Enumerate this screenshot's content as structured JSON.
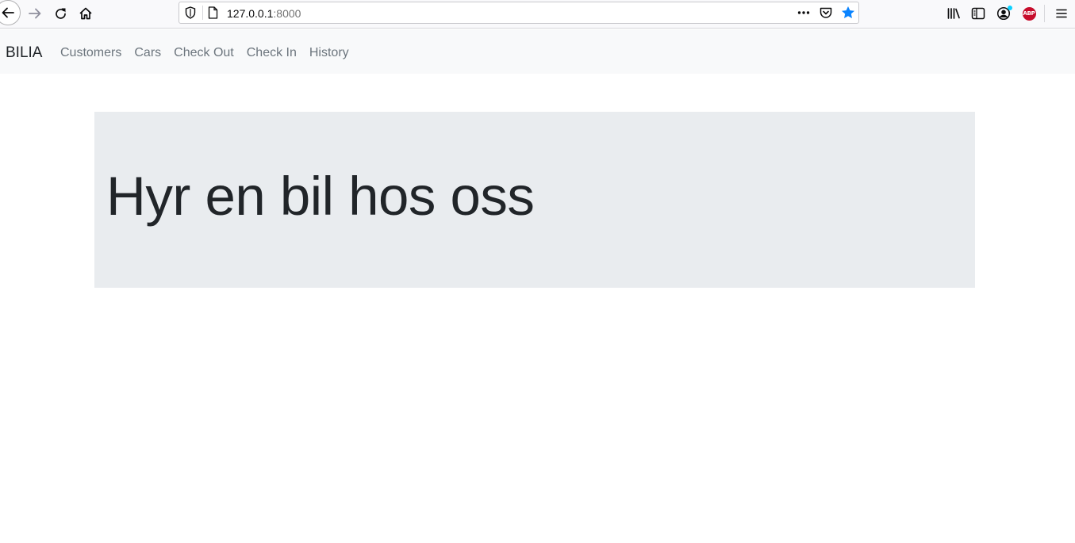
{
  "browser": {
    "url_host": "127.0.0.1",
    "url_port": ":8000",
    "icons": {
      "back": "back-arrow-icon",
      "forward": "forward-arrow-icon",
      "reload": "reload-icon",
      "home": "home-icon",
      "shield": "tracking-shield-icon",
      "page": "page-icon",
      "more": "more-actions-icon",
      "pocket": "pocket-icon",
      "bookmark": "bookmark-star-icon",
      "library": "library-icon",
      "sidebar": "sidebar-icon",
      "account": "account-icon",
      "adblock": "adblock-icon",
      "menu": "hamburger-menu-icon"
    },
    "adblock_label": "ABP",
    "colors": {
      "bookmark_star": "#0a84ff",
      "adblock": "#c70d2c"
    }
  },
  "navbar": {
    "brand": "BILIA",
    "links": [
      "Customers",
      "Cars",
      "Check Out",
      "Check In",
      "History"
    ]
  },
  "jumbotron": {
    "heading": "Hyr en bil hos oss"
  }
}
